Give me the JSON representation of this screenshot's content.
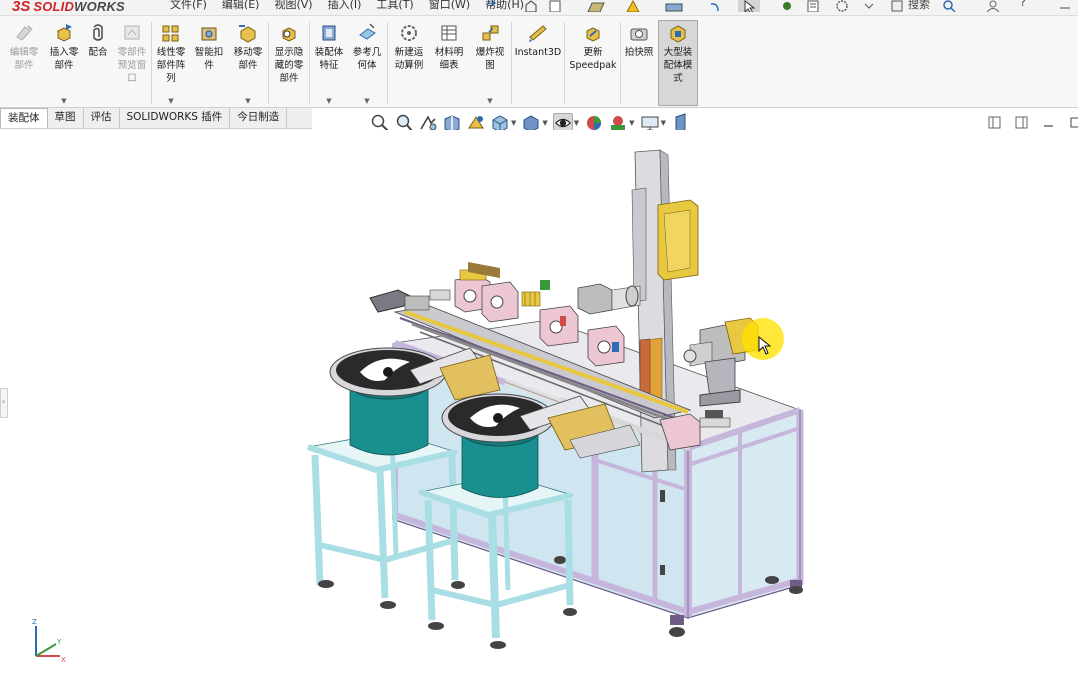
{
  "app": {
    "logo_ds": "3S",
    "logo_brand_a": "SOLID",
    "logo_brand_b": "WORKS"
  },
  "menu": [
    "文件(F)",
    "编辑(E)",
    "视图(V)",
    "插入(I)",
    "工具(T)",
    "窗口(W)",
    "帮助(H)"
  ],
  "ribbon": {
    "buttons": [
      {
        "id": "edit-component",
        "label": "编辑零\n部件",
        "disabled": true
      },
      {
        "id": "insert-components",
        "label": "插入零\n部件",
        "disabled": false
      },
      {
        "id": "mate",
        "label": "配合",
        "disabled": false
      },
      {
        "id": "component-preview",
        "label": "零部件\n预览窗\n口",
        "disabled": true
      },
      {
        "id": "linear-pattern",
        "label": "线性零\n部件阵\n列",
        "disabled": false
      },
      {
        "id": "smart-fasteners",
        "label": "智能扣\n件",
        "disabled": false
      },
      {
        "id": "move-component",
        "label": "移动零\n部件",
        "disabled": false
      },
      {
        "id": "show-hidden",
        "label": "显示隐\n藏的零\n部件",
        "disabled": false
      },
      {
        "id": "assembly-features",
        "label": "装配体\n特征",
        "disabled": false
      },
      {
        "id": "reference-geometry",
        "label": "参考几\n何体",
        "disabled": false
      },
      {
        "id": "new-motion-study",
        "label": "新建运\n动算例",
        "disabled": false
      },
      {
        "id": "bill-of-materials",
        "label": "材料明\n细表",
        "disabled": false
      },
      {
        "id": "exploded-view",
        "label": "爆炸视\n图",
        "disabled": false
      },
      {
        "id": "instant3d",
        "label": "Instant3D",
        "disabled": false
      },
      {
        "id": "update-speedpak",
        "label": "更新\nSpeedpak",
        "disabled": false
      },
      {
        "id": "take-snapshot",
        "label": "拍快照",
        "disabled": false
      },
      {
        "id": "large-assembly-mode",
        "label": "大型装\n配体模\n式",
        "disabled": false
      }
    ]
  },
  "tabs": [
    "装配体",
    "草图",
    "评估",
    "SOLIDWORKS 插件",
    "今日制造"
  ],
  "selected_tab": "装配体",
  "topright": {
    "search_text": "搜索"
  },
  "colors": {
    "frame": "#c7b6dc",
    "frame_edge": "#6e5b86",
    "panel": "#cfe6f0",
    "bowl": "#1a8f8f",
    "stand": "#a9dfe4",
    "motor": "#bdbdbd",
    "accent_yellow": "#e8c840",
    "cursor_highlight": "#ffe200"
  },
  "icons": [
    "zoom-to-fit-icon",
    "zoom-area-icon",
    "previous-view-icon",
    "section-view-icon",
    "dynamic-annotation-icon",
    "view-orientation-icon",
    "display-style-icon",
    "hide-show-icon",
    "edit-appearance-icon",
    "apply-scene-icon",
    "view-settings-icon",
    "display-pane-icon"
  ]
}
